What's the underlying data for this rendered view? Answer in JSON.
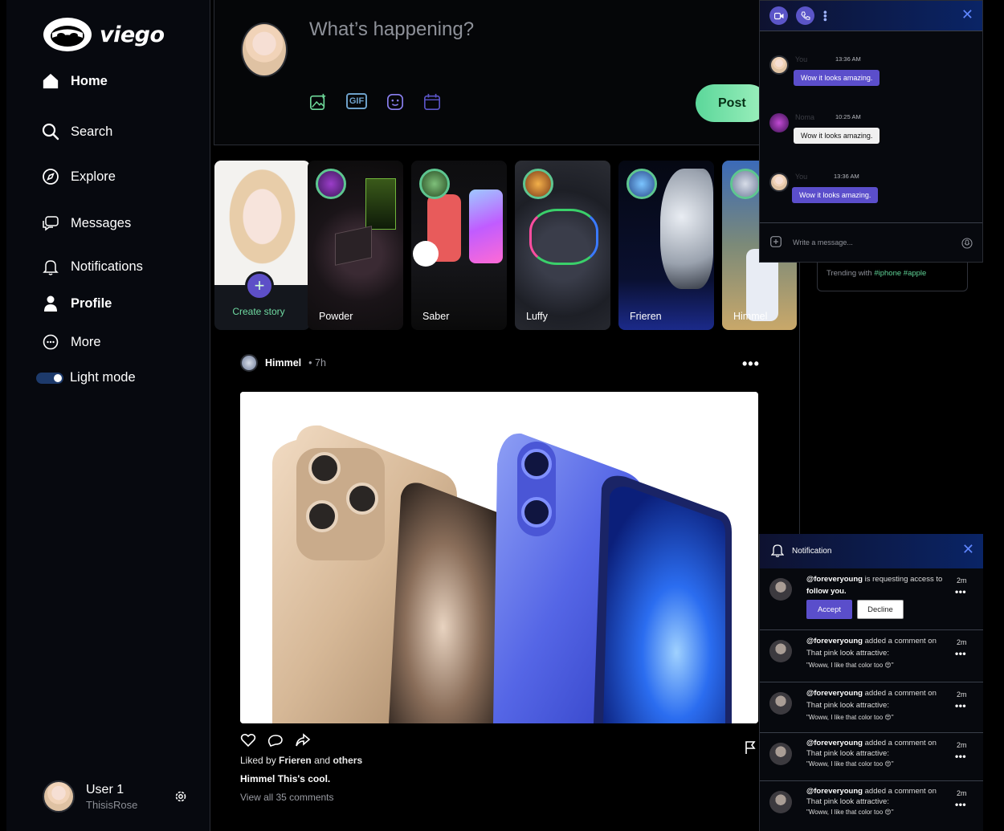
{
  "brand": {
    "name": "viego"
  },
  "nav": {
    "items": [
      {
        "label": "Home",
        "icon": "home-icon"
      },
      {
        "label": "Search",
        "icon": "search-icon"
      },
      {
        "label": "Explore",
        "icon": "compass-icon"
      },
      {
        "label": "Messages",
        "icon": "chat-icon"
      },
      {
        "label": "Notifications",
        "icon": "bell-icon"
      },
      {
        "label": "Profile",
        "icon": "person-icon"
      },
      {
        "label": "More",
        "icon": "more-icon"
      }
    ],
    "theme_toggle": "Light mode"
  },
  "user": {
    "name": "User 1",
    "handle": "ThisisRose"
  },
  "compose": {
    "placeholder": "What’s happening?",
    "gif_label": "GIF",
    "post_label": "Post"
  },
  "stories": {
    "create_label": "Create story",
    "items": [
      {
        "name": "Powder"
      },
      {
        "name": "Saber"
      },
      {
        "name": "Luffy"
      },
      {
        "name": "Frieren"
      },
      {
        "name": "Himmel"
      }
    ]
  },
  "post": {
    "author": "Himmel",
    "time": "• 7h",
    "liked_prefix": "Liked by",
    "liked_user": "Frieren",
    "liked_and": "and",
    "liked_suffix": "others",
    "caption_author": "Himmel",
    "caption_text": "This's cool.",
    "view_comments": "View all 35 comments"
  },
  "chat": {
    "messages": [
      {
        "sender": "You",
        "time": "13:36 AM",
        "text": "Wow it looks amazing.",
        "from_me": true
      },
      {
        "sender": "Noma",
        "time": "10:25 AM",
        "text": "Wow it looks amazing.",
        "from_me": false
      },
      {
        "sender": "You",
        "time": "13:36 AM",
        "text": "Wow it looks amazing.",
        "from_me": true
      }
    ],
    "input_placeholder": "Write a message..."
  },
  "trending": {
    "prefix": "Trending with",
    "tags": [
      "#iphone",
      "#apple"
    ]
  },
  "notifications": {
    "title": "Notification",
    "items": [
      {
        "user": "@foreveryoung",
        "action": "is requesting access to",
        "target": "follow you.",
        "time": "2m",
        "accept": "Accept",
        "decline": "Decline"
      },
      {
        "user": "@foreveryoung",
        "action": "added a comment on",
        "post": "That pink look attractive:",
        "quote": "\"Woww, I like that color too 😍\"",
        "time": "2m"
      },
      {
        "user": "@foreveryoung",
        "action": "added a comment on",
        "post": "That pink look attractive:",
        "quote": "\"Woww, I like that color too 😍\"",
        "time": "2m"
      },
      {
        "user": "@foreveryoung",
        "action": "added a comment on",
        "post": "That pink look attractive:",
        "quote": "\"Woww, I like that color too 😍\"",
        "time": "2m"
      },
      {
        "user": "@foreveryoung",
        "action": "added a comment on",
        "post": "That pink look attractive:",
        "quote": "\"Woww, I like that color too 😍\"",
        "time": "2m"
      }
    ]
  },
  "colors": {
    "accent_green": "#5ec690",
    "accent_purple": "#5b4ecb",
    "panel_blue": "#0a2466",
    "background": "#000000"
  }
}
